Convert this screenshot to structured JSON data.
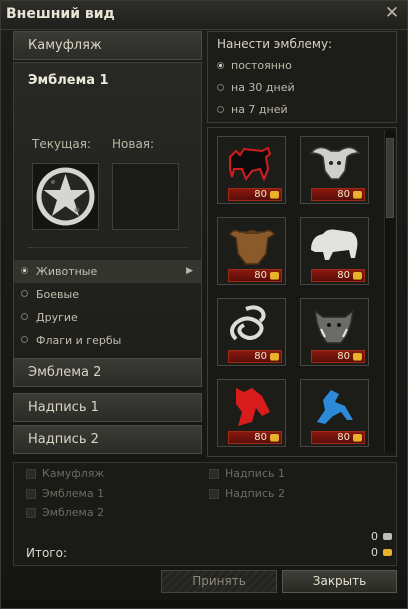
{
  "window": {
    "title": "Внешний вид"
  },
  "left": {
    "camouflage": "Камуфляж",
    "emblem1": "Эмблема 1",
    "current_label": "Текущая:",
    "new_label": "Новая:",
    "categories": [
      {
        "label": "Животные",
        "selected": true
      },
      {
        "label": "Боевые",
        "selected": false
      },
      {
        "label": "Другие",
        "selected": false
      },
      {
        "label": "Флаги и гербы",
        "selected": false
      }
    ],
    "emblem2": "Эмблема 2",
    "inscription1": "Надпись 1",
    "inscription2": "Надпись 2"
  },
  "apply": {
    "title": "Нанести эмблему:",
    "options": [
      {
        "label": "постоянно",
        "selected": true
      },
      {
        "label": "на 30 дней",
        "selected": false
      },
      {
        "label": "на 7 дней",
        "selected": false
      }
    ]
  },
  "emblems": [
    {
      "name": "bull-icon",
      "price": "80"
    },
    {
      "name": "buffalo-icon",
      "price": "80"
    },
    {
      "name": "bison-icon",
      "price": "80"
    },
    {
      "name": "white-bison-icon",
      "price": "80"
    },
    {
      "name": "snake-icon",
      "price": "80"
    },
    {
      "name": "boar-icon",
      "price": "80"
    },
    {
      "name": "red-horse-icon",
      "price": "80"
    },
    {
      "name": "blue-horse-icon",
      "price": "80"
    }
  ],
  "summary": {
    "checkboxes": [
      {
        "label": "Камуфляж"
      },
      {
        "label": "Эмблема 1"
      },
      {
        "label": "Эмблема 2"
      },
      {
        "label": "Надпись 1"
      },
      {
        "label": "Надпись 2"
      }
    ],
    "credits": "0",
    "gold": "0",
    "total_label": "Итого:"
  },
  "buttons": {
    "apply": "Принять",
    "close": "Закрыть"
  },
  "colors": {
    "price_bg": "#6f130c",
    "gold": "#e9b22a"
  }
}
